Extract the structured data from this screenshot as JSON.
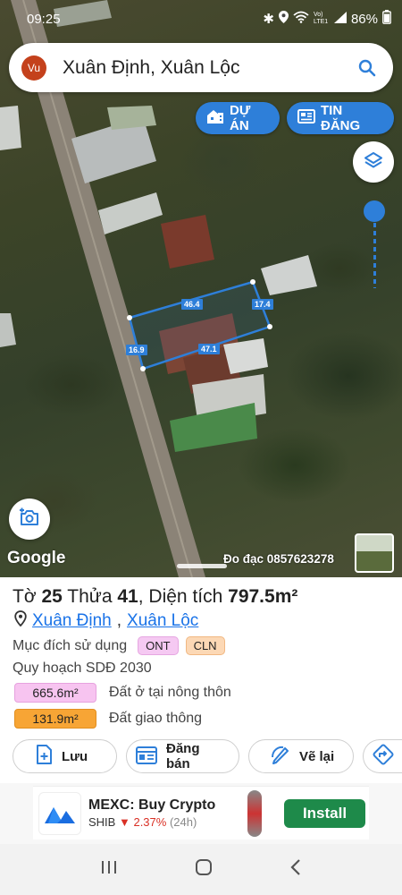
{
  "status": {
    "time": "09:25",
    "battery": "86%",
    "network": "Vo) LTE1"
  },
  "search": {
    "avatar": "Vu",
    "query": "Xuân Định, Xuân Lộc",
    "icon": "search-icon"
  },
  "map_buttons": {
    "du_an": "DỰ ÁN",
    "tin_dang": "TIN ĐĂNG"
  },
  "plot_edges": {
    "top": "46.4",
    "right": "17.4",
    "left": "16.9",
    "bottom": "47.1"
  },
  "map_footer": {
    "google": "Google",
    "contact": "Đo đạc 0857623278"
  },
  "parcel": {
    "to_label": "Tờ",
    "to_value": "25",
    "thua_label": "Thửa",
    "thua_value": "41",
    "area_label": "Diện tích",
    "area_value": "797.5m²",
    "commune": "Xuân Định",
    "district": "Xuân Lộc",
    "purpose_label": "Mục đích sử dụng",
    "purpose_codes": [
      "ONT",
      "CLN"
    ],
    "planning_label": "Quy hoạch SDĐ 2030",
    "planning": [
      {
        "area": "665.6m²",
        "label": "Đất ở tại nông thôn",
        "color": "#f7c4f0"
      },
      {
        "area": "131.9m²",
        "label": "Đất giao thông",
        "color": "#f7a535"
      }
    ]
  },
  "actions": {
    "save": "Lưu",
    "sell": "Đăng bán",
    "redraw": "Vẽ lại"
  },
  "ad": {
    "title": "MEXC: Buy Crypto",
    "ticker": "SHIB",
    "change": "2.37%",
    "period": "(24h)",
    "cta": "Install"
  }
}
